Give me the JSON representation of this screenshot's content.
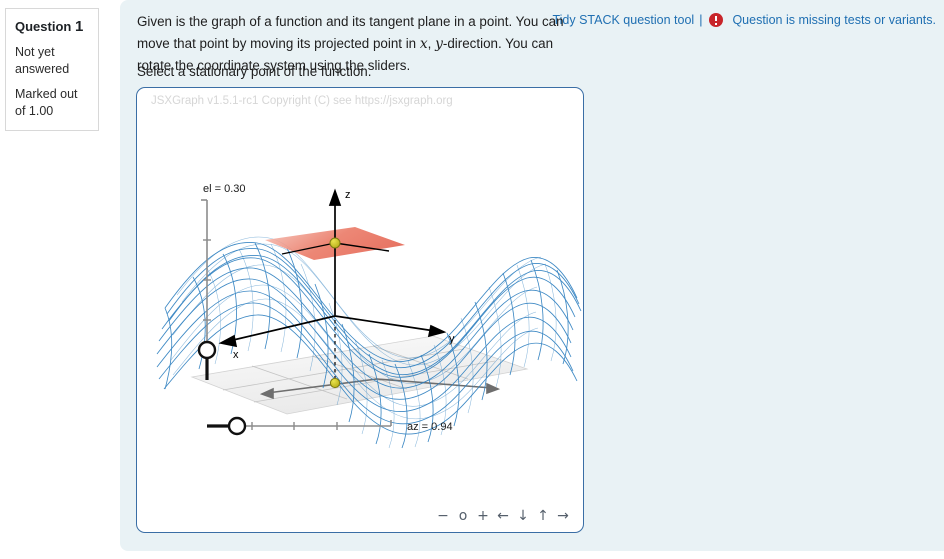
{
  "question_info": {
    "title_prefix": "Question",
    "number": "1",
    "state": "Not yet answered",
    "mark": "Marked out of 1.00"
  },
  "tidy_bar": {
    "link_label": "Tidy STACK question tool",
    "separator": "|",
    "error_icon": "error-circle-icon",
    "warning": "Question is missing tests or variants."
  },
  "question": {
    "para_part1": "Given is the graph of a function and its tangent plane in a point. You can move that point by moving its projected point in ",
    "math_x": "x",
    "comma": ", ",
    "math_y": "y",
    "para_part2": "-direction. You can rotate the coordinate system using the sliders.",
    "instruction": "Select a stationary point of the function."
  },
  "board": {
    "watermark": "JSXGraph v1.5.1-rc1 Copyright (C) see https://jsxgraph.org",
    "elevation_label": "el = 0.30",
    "azimuth_label": "az = 0.94",
    "axis_x": "x",
    "axis_y": "y",
    "axis_z": "z",
    "nav_buttons": [
      {
        "name": "zoom-out-icon",
        "glyph": "−"
      },
      {
        "name": "reset-zoom-icon",
        "glyph": "o"
      },
      {
        "name": "zoom-in-icon",
        "glyph": "+"
      },
      {
        "name": "pan-left-icon",
        "glyph": "←"
      },
      {
        "name": "pan-down-icon",
        "glyph": "↓"
      },
      {
        "name": "pan-up-icon",
        "glyph": "↑"
      },
      {
        "name": "pan-right-icon",
        "glyph": "→"
      }
    ]
  },
  "colors": {
    "surface_mesh": "#2f80c0",
    "tangent_plane": "#e8705f",
    "point_marker": "#c9c222",
    "board_border": "#3a6ea5",
    "content_bg": "#e9f2f5",
    "link": "#1f6fb2",
    "error": "#c8252a",
    "ground_grid": "#b0b0b0"
  },
  "chart_data": {
    "type": "surface3d",
    "title": "",
    "xlabel": "x",
    "ylabel": "y",
    "zlabel": "z",
    "elevation": 0.3,
    "azimuth": 0.94,
    "grid": true,
    "legend": "none",
    "annotations": [
      "el = 0.30",
      "az = 0.94"
    ],
    "overlays": [
      {
        "name": "tangent-plane",
        "color": "#e8705f"
      },
      {
        "name": "surface-point",
        "color": "#c9c222"
      },
      {
        "name": "projected-point",
        "color": "#c9c222"
      }
    ]
  }
}
